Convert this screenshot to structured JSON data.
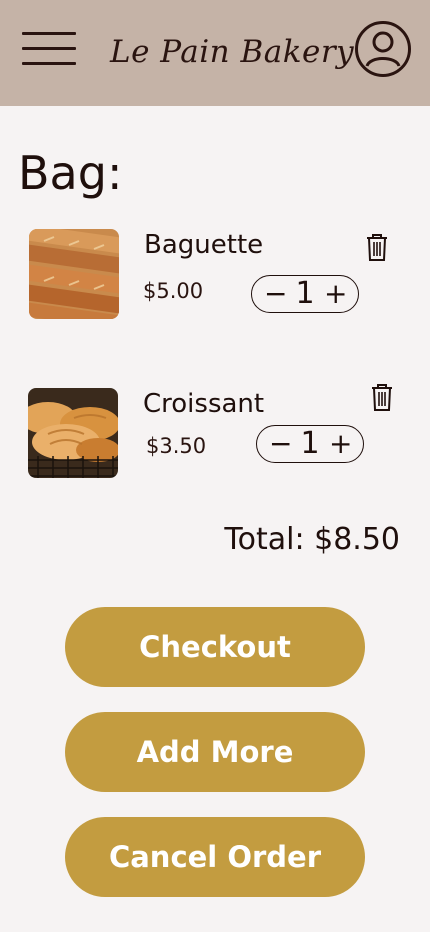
{
  "header": {
    "brand": "Le Pain Bakery",
    "background_color": "#c5b3a7",
    "menu_icon": "hamburger-menu-icon",
    "profile_icon": "user-profile-icon"
  },
  "bag": {
    "title": "Bag:",
    "items": [
      {
        "name": "Baguette",
        "price": "$5.00",
        "quantity": "1",
        "decrement": "−",
        "increment": "+",
        "image": "baguette-photo"
      },
      {
        "name": "Croissant",
        "price": "$3.50",
        "quantity": "1",
        "decrement": "−",
        "increment": "+",
        "image": "croissant-photo"
      }
    ],
    "total": "Total: $8.50"
  },
  "actions": {
    "checkout": "Checkout",
    "add_more": "Add More",
    "cancel_order": "Cancel Order",
    "button_color": "#c39c40"
  }
}
